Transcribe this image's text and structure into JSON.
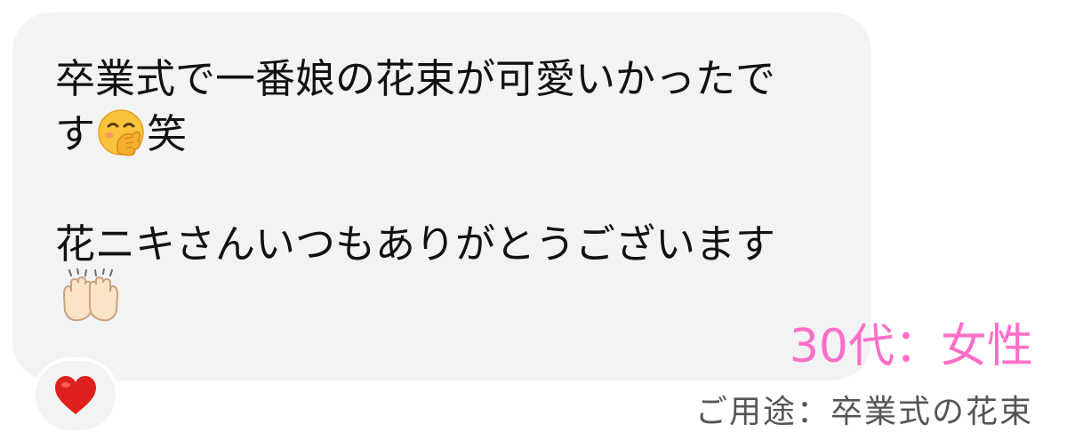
{
  "message": {
    "line1": "卒業式で一番娘の花束が可愛いかったで",
    "line2_before": "す",
    "line2_emoji": "hand-over-mouth-face-icon",
    "line2_after": "笑",
    "line3": "花ニキさんいつもありがとうございます",
    "line4_emoji": "raising-hands-icon"
  },
  "reaction": {
    "emoji": "red-heart-icon",
    "color": "#e0201e"
  },
  "caption": {
    "age_gender": "30代：女性",
    "usage": "ご用途：卒業式の花束",
    "age_color": "#ff6fc8",
    "usage_color": "#555555"
  }
}
